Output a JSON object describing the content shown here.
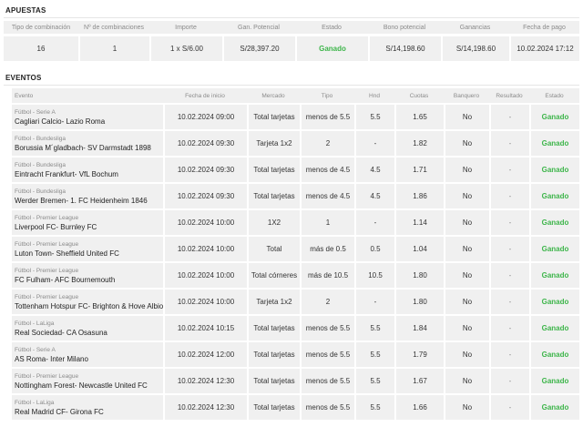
{
  "apuestas": {
    "title": "APUESTAS",
    "headers": [
      "Tipo de combinación",
      "Nº de combinaciones",
      "Importe",
      "Gan. Potencial",
      "Estado",
      "Bono potencial",
      "Ganancias",
      "Fecha de pago"
    ],
    "row": {
      "tipo": "16",
      "num": "1",
      "importe": "1 x S/6.00",
      "gan_potencial": "S/28,397.20",
      "estado": "Ganado",
      "bono": "S/14,198.60",
      "ganancias": "S/14,198.60",
      "fecha_pago": "10.02.2024 17:12"
    }
  },
  "eventos": {
    "title": "EVENTOS",
    "headers": [
      "Evento",
      "Fecha de inicio",
      "Mercado",
      "Tipo",
      "Hnd",
      "Cuotas",
      "Banquero",
      "Resultado",
      "Estado"
    ],
    "rows": [
      {
        "league": "Fútbol - Serie A",
        "teams": "Cagliari Calcio- Lazio Roma",
        "fecha": "10.02.2024 09:00",
        "mercado": "Total tarjetas",
        "tipo": "menos de 5.5",
        "hnd": "5.5",
        "cuota": "1.65",
        "banquero": "No",
        "resultado": "-",
        "estado": "Ganado"
      },
      {
        "league": "Fútbol - Bundesliga",
        "teams": "Borussia M´gladbach- SV Darmstadt 1898",
        "fecha": "10.02.2024 09:30",
        "mercado": "Tarjeta 1x2",
        "tipo": "2",
        "hnd": "-",
        "cuota": "1.82",
        "banquero": "No",
        "resultado": "-",
        "estado": "Ganado"
      },
      {
        "league": "Fútbol - Bundesliga",
        "teams": "Eintracht Frankfurt- VfL Bochum",
        "fecha": "10.02.2024 09:30",
        "mercado": "Total tarjetas",
        "tipo": "menos de 4.5",
        "hnd": "4.5",
        "cuota": "1.71",
        "banquero": "No",
        "resultado": "-",
        "estado": "Ganado"
      },
      {
        "league": "Fútbol - Bundesliga",
        "teams": "Werder Bremen- 1. FC Heidenheim 1846",
        "fecha": "10.02.2024 09:30",
        "mercado": "Total tarjetas",
        "tipo": "menos de 4.5",
        "hnd": "4.5",
        "cuota": "1.86",
        "banquero": "No",
        "resultado": "-",
        "estado": "Ganado"
      },
      {
        "league": "Fútbol - Premier League",
        "teams": "Liverpool FC- Burnley FC",
        "fecha": "10.02.2024 10:00",
        "mercado": "1X2",
        "tipo": "1",
        "hnd": "-",
        "cuota": "1.14",
        "banquero": "No",
        "resultado": "-",
        "estado": "Ganado"
      },
      {
        "league": "Fútbol - Premier League",
        "teams": "Luton Town- Sheffield United FC",
        "fecha": "10.02.2024 10:00",
        "mercado": "Total",
        "tipo": "más de 0.5",
        "hnd": "0.5",
        "cuota": "1.04",
        "banquero": "No",
        "resultado": "-",
        "estado": "Ganado"
      },
      {
        "league": "Fútbol - Premier League",
        "teams": "FC Fulham- AFC Bournemouth",
        "fecha": "10.02.2024 10:00",
        "mercado": "Total córneres",
        "tipo": "más de 10.5",
        "hnd": "10.5",
        "cuota": "1.80",
        "banquero": "No",
        "resultado": "-",
        "estado": "Ganado"
      },
      {
        "league": "Fútbol - Premier League",
        "teams": "Tottenham Hotspur FC- Brighton & Hove Albion",
        "fecha": "10.02.2024 10:00",
        "mercado": "Tarjeta 1x2",
        "tipo": "2",
        "hnd": "-",
        "cuota": "1.80",
        "banquero": "No",
        "resultado": "-",
        "estado": "Ganado"
      },
      {
        "league": "Fútbol - LaLiga",
        "teams": "Real Sociedad- CA Osasuna",
        "fecha": "10.02.2024 10:15",
        "mercado": "Total tarjetas",
        "tipo": "menos de 5.5",
        "hnd": "5.5",
        "cuota": "1.84",
        "banquero": "No",
        "resultado": "-",
        "estado": "Ganado"
      },
      {
        "league": "Fútbol - Serie A",
        "teams": "AS Roma- Inter Milano",
        "fecha": "10.02.2024 12:00",
        "mercado": "Total tarjetas",
        "tipo": "menos de 5.5",
        "hnd": "5.5",
        "cuota": "1.79",
        "banquero": "No",
        "resultado": "-",
        "estado": "Ganado"
      },
      {
        "league": "Fútbol - Premier League",
        "teams": "Nottingham Forest- Newcastle United FC",
        "fecha": "10.02.2024 12:30",
        "mercado": "Total tarjetas",
        "tipo": "menos de 5.5",
        "hnd": "5.5",
        "cuota": "1.67",
        "banquero": "No",
        "resultado": "-",
        "estado": "Ganado"
      },
      {
        "league": "Fútbol - LaLiga",
        "teams": "Real Madrid CF- Girona FC",
        "fecha": "10.02.2024 12:30",
        "mercado": "Total tarjetas",
        "tipo": "menos de 5.5",
        "hnd": "5.5",
        "cuota": "1.66",
        "banquero": "No",
        "resultado": "-",
        "estado": "Ganado"
      }
    ]
  },
  "colors": {
    "won": "#3db54a",
    "row_bg": "#f0f0f0",
    "header_text": "#8a8a8a"
  }
}
